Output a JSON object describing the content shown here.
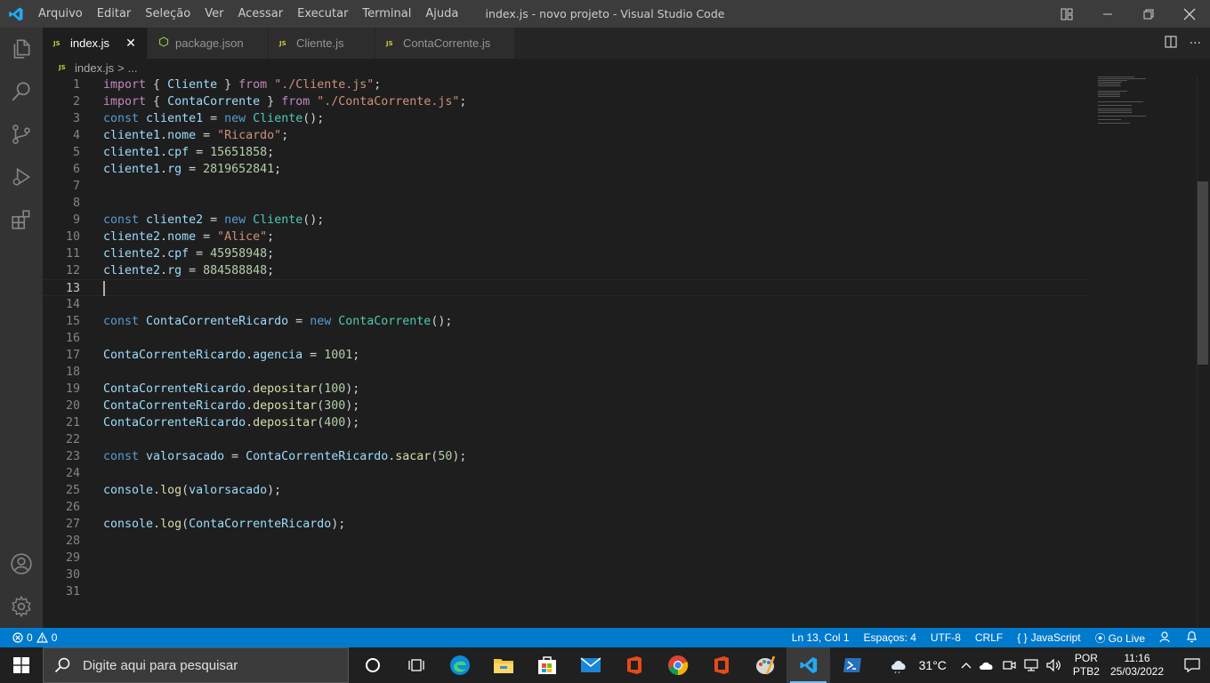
{
  "titlebar": {
    "menu": [
      "Arquivo",
      "Editar",
      "Seleção",
      "Ver",
      "Acessar",
      "Executar",
      "Terminal",
      "Ajuda"
    ],
    "title": "index.js - novo projeto - Visual Studio Code"
  },
  "tabs": [
    {
      "label": "index.js",
      "icon": "js-file-icon",
      "active": true
    },
    {
      "label": "package.json",
      "icon": "npm-file-icon",
      "active": false
    },
    {
      "label": "Cliente.js",
      "icon": "js-file-icon",
      "active": false
    },
    {
      "label": "ContaCorrente.js",
      "icon": "js-file-icon",
      "active": false
    }
  ],
  "breadcrumb": {
    "file": "index.js",
    "separator": ">",
    "more": "..."
  },
  "editor": {
    "current_line": 13,
    "lines": [
      {
        "n": "1",
        "tokens": [
          [
            "imp",
            "import"
          ],
          [
            "pl",
            " { "
          ],
          [
            "var",
            "Cliente"
          ],
          [
            "pl",
            " } "
          ],
          [
            "imp",
            "from"
          ],
          [
            "pl",
            " "
          ],
          [
            "str",
            "\"./Cliente.js\""
          ],
          [
            "pl",
            ";"
          ]
        ]
      },
      {
        "n": "2",
        "tokens": [
          [
            "imp",
            "import"
          ],
          [
            "pl",
            " { "
          ],
          [
            "var",
            "ContaCorrente"
          ],
          [
            "pl",
            " } "
          ],
          [
            "imp",
            "from"
          ],
          [
            "pl",
            " "
          ],
          [
            "str",
            "\"./ContaCorrente.js\""
          ],
          [
            "pl",
            ";"
          ]
        ]
      },
      {
        "n": "3",
        "tokens": [
          [
            "kw",
            "const"
          ],
          [
            "pl",
            " "
          ],
          [
            "var",
            "cliente1"
          ],
          [
            "pl",
            " = "
          ],
          [
            "kw",
            "new"
          ],
          [
            "pl",
            " "
          ],
          [
            "cls",
            "Cliente"
          ],
          [
            "pl",
            "();"
          ]
        ]
      },
      {
        "n": "4",
        "tokens": [
          [
            "var",
            "cliente1"
          ],
          [
            "pl",
            "."
          ],
          [
            "var",
            "nome"
          ],
          [
            "pl",
            " = "
          ],
          [
            "str",
            "\"Ricardo\""
          ],
          [
            "pl",
            ";"
          ]
        ]
      },
      {
        "n": "5",
        "tokens": [
          [
            "var",
            "cliente1"
          ],
          [
            "pl",
            "."
          ],
          [
            "var",
            "cpf"
          ],
          [
            "pl",
            " = "
          ],
          [
            "num",
            "15651858"
          ],
          [
            "pl",
            ";"
          ]
        ]
      },
      {
        "n": "6",
        "tokens": [
          [
            "var",
            "cliente1"
          ],
          [
            "pl",
            "."
          ],
          [
            "var",
            "rg"
          ],
          [
            "pl",
            " = "
          ],
          [
            "num",
            "2819652841"
          ],
          [
            "pl",
            ";"
          ]
        ]
      },
      {
        "n": "7",
        "tokens": []
      },
      {
        "n": "8",
        "tokens": []
      },
      {
        "n": "9",
        "tokens": [
          [
            "kw",
            "const"
          ],
          [
            "pl",
            " "
          ],
          [
            "var",
            "cliente2"
          ],
          [
            "pl",
            " = "
          ],
          [
            "kw",
            "new"
          ],
          [
            "pl",
            " "
          ],
          [
            "cls",
            "Cliente"
          ],
          [
            "pl",
            "();"
          ]
        ]
      },
      {
        "n": "10",
        "tokens": [
          [
            "var",
            "cliente2"
          ],
          [
            "pl",
            "."
          ],
          [
            "var",
            "nome"
          ],
          [
            "pl",
            " = "
          ],
          [
            "str",
            "\"Alice\""
          ],
          [
            "pl",
            ";"
          ]
        ]
      },
      {
        "n": "11",
        "tokens": [
          [
            "var",
            "cliente2"
          ],
          [
            "pl",
            "."
          ],
          [
            "var",
            "cpf"
          ],
          [
            "pl",
            " = "
          ],
          [
            "num",
            "45958948"
          ],
          [
            "pl",
            ";"
          ]
        ]
      },
      {
        "n": "12",
        "tokens": [
          [
            "var",
            "cliente2"
          ],
          [
            "pl",
            "."
          ],
          [
            "var",
            "rg"
          ],
          [
            "pl",
            " = "
          ],
          [
            "num",
            "884588848"
          ],
          [
            "pl",
            ";"
          ]
        ]
      },
      {
        "n": "13",
        "tokens": []
      },
      {
        "n": "14",
        "tokens": []
      },
      {
        "n": "15",
        "tokens": [
          [
            "kw",
            "const"
          ],
          [
            "pl",
            " "
          ],
          [
            "var",
            "ContaCorrenteRicardo"
          ],
          [
            "pl",
            " = "
          ],
          [
            "kw",
            "new"
          ],
          [
            "pl",
            " "
          ],
          [
            "cls",
            "ContaCorrente"
          ],
          [
            "pl",
            "();"
          ]
        ]
      },
      {
        "n": "16",
        "tokens": []
      },
      {
        "n": "17",
        "tokens": [
          [
            "var",
            "ContaCorrenteRicardo"
          ],
          [
            "pl",
            "."
          ],
          [
            "var",
            "agencia"
          ],
          [
            "pl",
            " = "
          ],
          [
            "num",
            "1001"
          ],
          [
            "pl",
            ";"
          ]
        ]
      },
      {
        "n": "18",
        "tokens": []
      },
      {
        "n": "19",
        "tokens": [
          [
            "var",
            "ContaCorrenteRicardo"
          ],
          [
            "pl",
            "."
          ],
          [
            "fn",
            "depositar"
          ],
          [
            "pl",
            "("
          ],
          [
            "num",
            "100"
          ],
          [
            "pl",
            ");"
          ]
        ]
      },
      {
        "n": "20",
        "tokens": [
          [
            "var",
            "ContaCorrenteRicardo"
          ],
          [
            "pl",
            "."
          ],
          [
            "fn",
            "depositar"
          ],
          [
            "pl",
            "("
          ],
          [
            "num",
            "300"
          ],
          [
            "pl",
            ");"
          ]
        ]
      },
      {
        "n": "21",
        "tokens": [
          [
            "var",
            "ContaCorrenteRicardo"
          ],
          [
            "pl",
            "."
          ],
          [
            "fn",
            "depositar"
          ],
          [
            "pl",
            "("
          ],
          [
            "num",
            "400"
          ],
          [
            "pl",
            ");"
          ]
        ]
      },
      {
        "n": "22",
        "tokens": []
      },
      {
        "n": "23",
        "tokens": [
          [
            "kw",
            "const"
          ],
          [
            "pl",
            " "
          ],
          [
            "var",
            "valorsacado"
          ],
          [
            "pl",
            " = "
          ],
          [
            "var",
            "ContaCorrenteRicardo"
          ],
          [
            "pl",
            "."
          ],
          [
            "fn",
            "sacar"
          ],
          [
            "pl",
            "("
          ],
          [
            "num",
            "50"
          ],
          [
            "pl",
            ");"
          ]
        ]
      },
      {
        "n": "24",
        "tokens": []
      },
      {
        "n": "25",
        "tokens": [
          [
            "var",
            "console"
          ],
          [
            "pl",
            "."
          ],
          [
            "fn",
            "log"
          ],
          [
            "pl",
            "("
          ],
          [
            "var",
            "valorsacado"
          ],
          [
            "pl",
            ");"
          ]
        ]
      },
      {
        "n": "26",
        "tokens": []
      },
      {
        "n": "27",
        "tokens": [
          [
            "var",
            "console"
          ],
          [
            "pl",
            "."
          ],
          [
            "fn",
            "log"
          ],
          [
            "pl",
            "("
          ],
          [
            "var",
            "ContaCorrenteRicardo"
          ],
          [
            "pl",
            ");"
          ]
        ]
      },
      {
        "n": "28",
        "tokens": []
      },
      {
        "n": "29",
        "tokens": []
      },
      {
        "n": "30",
        "tokens": []
      },
      {
        "n": "31",
        "tokens": []
      }
    ]
  },
  "statusbar": {
    "errors": "0",
    "warnings": "0",
    "position": "Ln 13, Col 1",
    "spaces": "Espaços: 4",
    "encoding": "UTF-8",
    "eol": "CRLF",
    "language": "JavaScript",
    "golive": "Go Live"
  },
  "taskbar": {
    "search_placeholder": "Digite aqui para pesquisar",
    "apps": [
      "cortana-icon",
      "task-view-icon",
      "edge-icon",
      "file-explorer-icon",
      "store-icon",
      "mail-icon",
      "office-icon",
      "chrome-icon",
      "office-alt-icon",
      "paint-icon",
      "vscode-icon",
      "powershell-icon"
    ],
    "temperature": "31°C",
    "lang_1": "POR",
    "lang_2": "PTB2",
    "time": "11:16",
    "date": "25/03/2022"
  },
  "colors": {
    "accent": "#007acc",
    "titlebar": "#3c3c3c",
    "activitybar": "#333333",
    "editor_bg": "#1e1e1e",
    "keyword": "#569cd6",
    "import": "#c586c0",
    "string": "#ce9178",
    "number": "#b5cea8",
    "variable": "#9cdcfe",
    "class": "#4ec9b0",
    "function": "#dcdcaa"
  }
}
